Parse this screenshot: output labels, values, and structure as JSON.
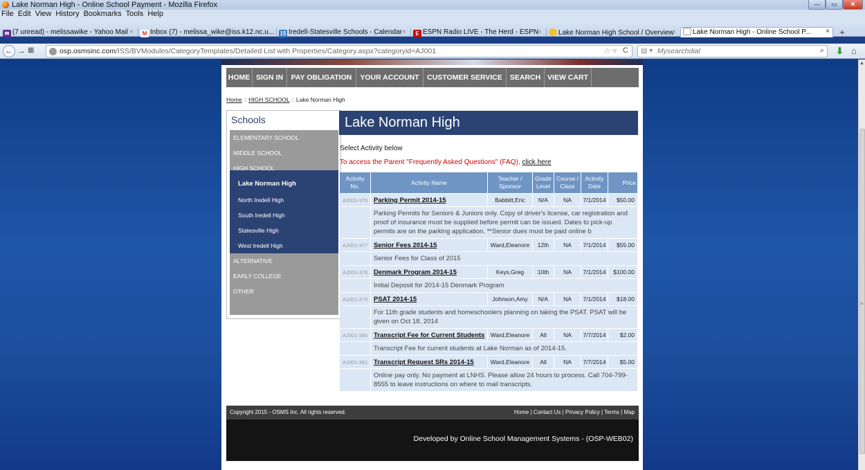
{
  "window": {
    "title": "Lake Norman High - Online School Payment - Mozilla Firefox",
    "min_glyph": "—",
    "max_glyph": "▭",
    "close_glyph": "✕"
  },
  "menu": [
    "File",
    "Edit",
    "View",
    "History",
    "Bookmarks",
    "Tools",
    "Help"
  ],
  "tabs": [
    {
      "label": "(7 unread) - melissawike - Yahoo Mail",
      "icon": "mail-icon",
      "color": "#5c2d91"
    },
    {
      "label": "Inbox (7) - melissa_wike@iss.k12.nc.u...",
      "icon": "gmail-icon",
      "color": "#d93025"
    },
    {
      "label": "Iredell-Statesville Schools - Calendar",
      "icon": "calendar-icon",
      "color": "#3b7bbf"
    },
    {
      "label": "ESPN Radio LIVE - The Herd - ESPN",
      "icon": "espn-icon",
      "color": "#cc0000"
    },
    {
      "label": "Lake Norman High School / Overview",
      "icon": "sun-icon",
      "color": "#f2c230"
    },
    {
      "label": "Lake Norman High - Online School P...",
      "icon": "page-icon",
      "color": "#ffffff"
    }
  ],
  "tab_close_glyph": "×",
  "new_tab_glyph": "+",
  "nav": {
    "back_glyph": "←",
    "forward_glyph": "→",
    "list_glyph": "▦",
    "url_host": "osp.osmsinc.com",
    "url_path": "/ISS/BVModules/CategoryTemplates/Detailed List with Properties/Category.aspx?categoryid=AJ001",
    "star_glyph": "☆ ▿",
    "reload_glyph": "C",
    "search_engine_glyph": "▤ ▾",
    "search_placeholder": "Mysearchdial",
    "search_glyph": "⌕",
    "download_glyph": "⬇",
    "home_glyph": "⌂"
  },
  "site_nav": [
    "HOME",
    "SIGN IN",
    "PAY OBLIGATION",
    "YOUR ACCOUNT",
    "CUSTOMER SERVICE",
    "SEARCH",
    "VIEW CART"
  ],
  "breadcrumb": {
    "home": "Home",
    "sep": "::",
    "level": "HIGH SCHOOL",
    "current": "Lake Norman High"
  },
  "sidebar": {
    "heading": "Schools",
    "categories_top": [
      "ELEMENTARY SCHOOL",
      "MIDDLE SCHOOL",
      "HIGH SCHOOL"
    ],
    "schools": [
      "Lake Norman High",
      "North Iredell High",
      "South Iredell High",
      "Statesville High",
      "West Iredell High"
    ],
    "categories_bottom": [
      "ALTERNATIVE",
      "EARLY COLLEGE",
      "OTHER"
    ]
  },
  "main": {
    "title": "Lake Norman High",
    "select_label": "Select Activity below",
    "faq_text": "To access the Parent \"Frequently Asked Questions\" (FAQ),",
    "faq_link": "click here"
  },
  "table": {
    "headers": {
      "no": [
        "Activity",
        "No."
      ],
      "name": "Activity Name",
      "teacher": [
        "Teacher /",
        "Sponsor"
      ],
      "grade": [
        "Grade",
        "Level"
      ],
      "course": [
        "Course /",
        "Class"
      ],
      "date": [
        "Activity",
        "Date"
      ],
      "price": "Price"
    },
    "rows": [
      {
        "no": "AJ001-376",
        "name": "Parking Permit 2014-15",
        "teacher": "Babbitt,Eric",
        "grade": "N/A",
        "course": "NA",
        "date": "7/1/2014",
        "price": "$50.00",
        "desc": "Parking Permits for Seniors & Juniors only. Copy of driver's license, car registration and proof of insurance must be supplied before permit can be issued. Dates to pick-up permits are on the parking application. **Senior dues must be paid online b"
      },
      {
        "no": "AJ001-377",
        "name": "Senior Fees 2014-15",
        "teacher": "Ward,Eleanore",
        "grade": "12th",
        "course": "NA",
        "date": "7/1/2014",
        "price": "$55.00",
        "desc": "Senior Fees for Class of 2015"
      },
      {
        "no": "AJ001-378",
        "name": "Denmark Program 2014-15",
        "teacher": "Keys,Greg",
        "grade": "10th",
        "course": "NA",
        "date": "7/1/2014",
        "price": "$100.00",
        "desc": "Initial Deposit for 2014-15 Denmark Program"
      },
      {
        "no": "AJ001-379",
        "name": "PSAT 2014-15",
        "teacher": "Johnson,Amy",
        "grade": "N/A",
        "course": "NA",
        "date": "7/1/2014",
        "price": "$18.00",
        "desc": "For 11th grade students and homeschoolers planning on taking the PSAT. PSAT will be given on Oct 18, 2014"
      },
      {
        "no": "AJ001-380",
        "name": "Transcript Fee for Current Students",
        "teacher": "Ward,Eleanore",
        "grade": "All",
        "course": "NA",
        "date": "7/7/2014",
        "price": "$2.00",
        "desc": "Transcript Fee for current students at Lake Norman as of 2014-15."
      },
      {
        "no": "AJ001-381",
        "name": "Transcript Request SRs 2014-15",
        "teacher": "Ward,Eleanore",
        "grade": "All",
        "course": "NA",
        "date": "7/7/2014",
        "price": "$5.00",
        "desc": "Online pay only. No payment at LNHS. Please allow 24 hours to process. Call 704-799-8555 to leave instructions on where to mail transcripts."
      }
    ]
  },
  "footer": {
    "copyright": "Copyright 2015 - OSMS Inc. All rights reserved.",
    "links": [
      "Home",
      "Contact Us",
      "Privacy Policy",
      "Terms",
      "Map"
    ],
    "link_sep": "|",
    "developer": "Developed by Online School Management Systems - (OSP-WEB02)"
  },
  "colors": {
    "nav_gray": "#6d6d6d",
    "school_blue": "#2b4373",
    "header_blue": "#6f95c5",
    "row_blue": "#dbe7f5",
    "faq_red": "#d40000"
  }
}
